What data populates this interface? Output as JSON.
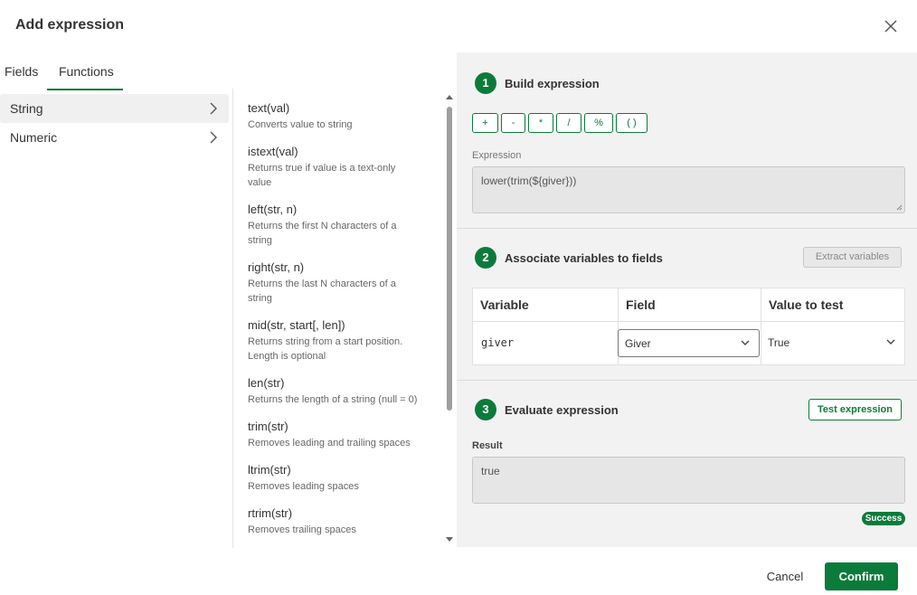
{
  "dialog": {
    "title": "Add expression"
  },
  "tabs": [
    {
      "label": "Fields",
      "active": false
    },
    {
      "label": "Functions",
      "active": true
    }
  ],
  "categories": [
    {
      "label": "String",
      "selected": true
    },
    {
      "label": "Numeric",
      "selected": false
    }
  ],
  "functions": [
    {
      "name": "text(val)",
      "description": "Converts value to string"
    },
    {
      "name": "istext(val)",
      "description": "Returns true if value is a text-only value"
    },
    {
      "name": "left(str, n)",
      "description": "Returns the first N characters of a string"
    },
    {
      "name": "right(str, n)",
      "description": "Returns the last N characters of a string"
    },
    {
      "name": "mid(str, start[, len])",
      "description": "Returns string from a start position. Length is optional"
    },
    {
      "name": "len(str)",
      "description": "Returns the length of a string (null = 0)"
    },
    {
      "name": "trim(str)",
      "description": "Removes leading and trailing spaces"
    },
    {
      "name": "ltrim(str)",
      "description": "Removes leading spaces"
    },
    {
      "name": "rtrim(str)",
      "description": "Removes trailing spaces"
    }
  ],
  "build": {
    "step": "1",
    "title": "Build expression",
    "operators": [
      "+",
      "-",
      "*",
      "/",
      "%",
      "( )"
    ],
    "expression_label": "Expression",
    "expression_value": "lower(trim(${giver}))"
  },
  "associate": {
    "step": "2",
    "title": "Associate variables to fields",
    "extract_label": "Extract variables",
    "columns": [
      "Variable",
      "Field",
      "Value to test"
    ],
    "rows": [
      {
        "variable": "giver",
        "field": "Giver",
        "value": "True"
      }
    ]
  },
  "evaluate": {
    "step": "3",
    "title": "Evaluate expression",
    "test_label": "Test expression",
    "result_label": "Result",
    "result_value": "true",
    "status": "Success"
  },
  "footer": {
    "cancel_label": "Cancel",
    "confirm_label": "Confirm"
  },
  "colors": {
    "accent": "#0b7b3a",
    "panel_bg": "#f2f2f2"
  }
}
